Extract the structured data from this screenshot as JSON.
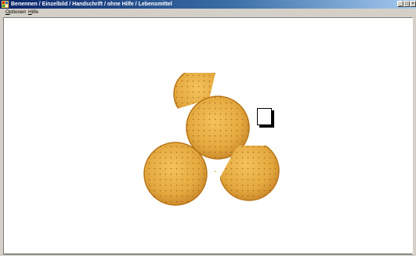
{
  "window": {
    "title": "Benennen / Einzelbild / Handschrift / ohne Hilfe / Lebensmittel",
    "min_label": "_",
    "max_label": "□",
    "close_label": "×"
  },
  "menu": {
    "options": {
      "mnemonic": "O",
      "rest": "ptionen"
    },
    "help": {
      "mnemonic": "H",
      "rest": "ilfe"
    }
  },
  "picture": {
    "subject": "biscuits",
    "count": 4
  },
  "colors": {
    "titlebar": "#0a246a",
    "biscuit": "#e4a93e",
    "biscuit_edge": "#b87518",
    "dots": "#8a4d10"
  }
}
